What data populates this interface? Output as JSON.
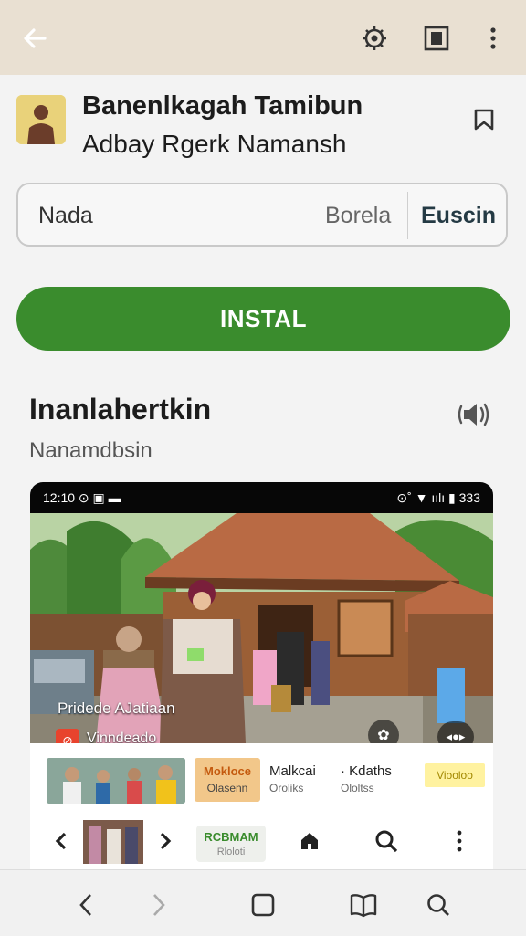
{
  "topbar": {
    "back_icon": "back-arrow-icon",
    "icons": [
      "settings-gear-icon",
      "tab-square-icon",
      "more-vertical-icon"
    ]
  },
  "app": {
    "icon": "person-avatar-icon",
    "title": "Banenlkagah Tamibun",
    "subtitle": "Adbay Rgerk Namansh",
    "bookmark_icon": "bookmark-icon"
  },
  "search": {
    "value": "Nada",
    "secondary": "Borela",
    "button": "Euscin"
  },
  "install_label": "INSTAL",
  "section": {
    "title": "Inanlahertkin",
    "subtitle": "Nanamdbsin",
    "speaker_icon": "speaker-icon"
  },
  "phone": {
    "status_left": "12:10 ⊙ ▣ ▬",
    "status_right": "⊙˚ ▼ ıılı ▮ 333",
    "overlay_line1": "Pridede AJatiaan",
    "overlay_badge": "⊘",
    "overlay_line2": "Vinndeado",
    "btn1": "✿",
    "btn2": "◂●▸",
    "card_chip": {
      "line1": "Mokloce",
      "line2": "Olasenn"
    },
    "stats": [
      {
        "line1": "Malkcai",
        "line2": "Oroliks"
      },
      {
        "line1": "· Kdaths",
        "line2": "Ololtss"
      }
    ],
    "tag": "Viooloo",
    "ext_chip": {
      "line1": "RCBMAM",
      "line2": "Rloloti"
    }
  },
  "bottom_nav": [
    "back-chevron-icon",
    "forward-chevron-icon",
    "square-icon",
    "book-icon",
    "search-icon"
  ],
  "colors": {
    "install": "#3a8c2d",
    "topbar": "#e9e0d2",
    "accent_red": "#e8432d"
  }
}
